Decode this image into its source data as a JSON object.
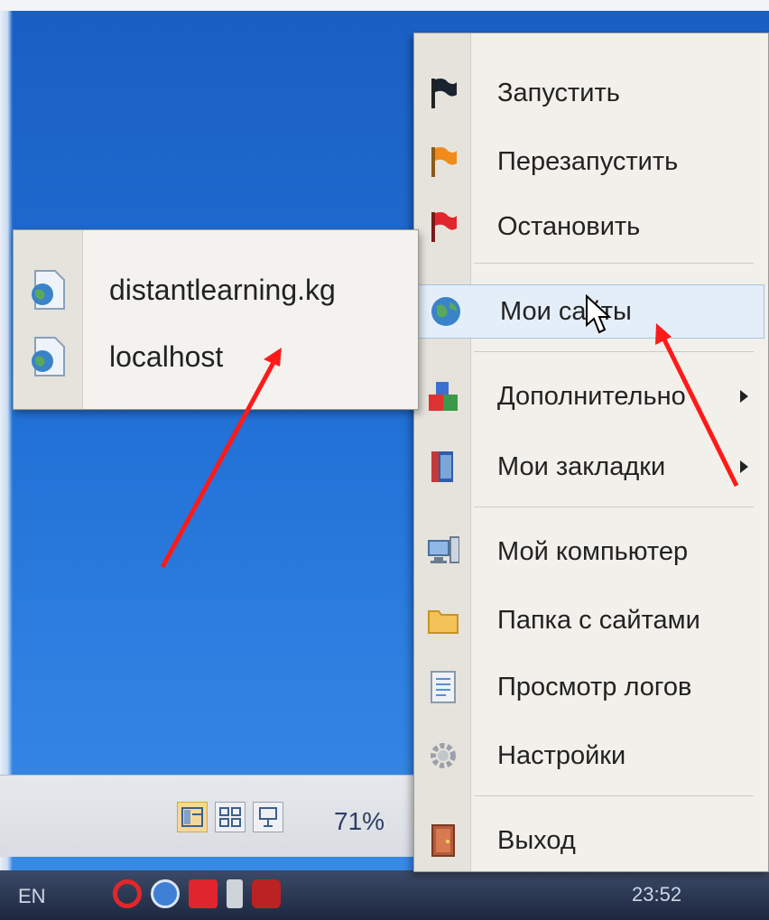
{
  "desktop": {
    "status_bar": {
      "zoom_text": "71%",
      "view_buttons": [
        "normal-view-icon",
        "slide-sorter-icon",
        "slideshow-icon"
      ]
    },
    "taskbar": {
      "lang": "EN",
      "time": "23:52",
      "tray_icons": [
        "opera-icon",
        "update-icon",
        "antivirus-icon",
        "battery-icon",
        "network-icon"
      ]
    }
  },
  "context_menu": {
    "items": [
      {
        "label": "Запустить",
        "icon": "flag-black-icon"
      },
      {
        "label": "Перезапустить",
        "icon": "flag-orange-icon"
      },
      {
        "label": "Остановить",
        "icon": "flag-red-icon"
      },
      {
        "label": "Мои сайты",
        "icon": "globe-icon",
        "highlighted": true
      },
      {
        "label": "Дополнительно",
        "icon": "shapes-icon",
        "submenu": true
      },
      {
        "label": "Мои закладки",
        "icon": "book-icon",
        "submenu": true
      },
      {
        "label": "Мой компьютер",
        "icon": "computer-icon"
      },
      {
        "label": "Папка с сайтами",
        "icon": "folder-icon"
      },
      {
        "label": "Просмотр логов",
        "icon": "log-icon"
      },
      {
        "label": "Настройки",
        "icon": "gear-icon"
      },
      {
        "label": "Выход",
        "icon": "door-icon"
      }
    ]
  },
  "submenu": {
    "items": [
      {
        "label": "distantlearning.kg",
        "icon": "site-file-icon"
      },
      {
        "label": "localhost",
        "icon": "site-file-icon"
      }
    ]
  },
  "colors": {
    "desktop_blue": "#1f64c4",
    "menu_bg": "#f2f0ea",
    "highlight": "#e4eef9",
    "annotation_arrow": "#ff1a1a"
  }
}
